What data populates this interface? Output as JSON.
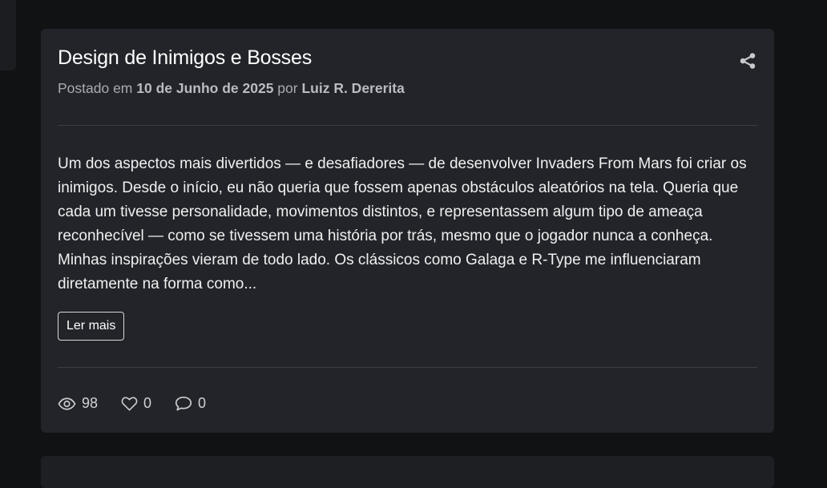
{
  "post": {
    "title": "Design de Inimigos e Bosses",
    "meta_prefix": "Postado em ",
    "date": "10 de Junho de 2025",
    "meta_by": " por ",
    "author": "Luiz R. Dererita",
    "excerpt": "Um dos aspectos mais divertidos — e desafiadores — de desenvolver Invaders From Mars foi criar os inimigos. Desde o início, eu não queria que fossem apenas obstáculos aleatórios na tela. Queria que cada um tivesse personalidade, movimentos distintos, e representassem algum tipo de ameaça reconhecível — como se tivessem uma história por trás, mesmo que o jogador nunca a conheça. Minhas inspirações vieram de todo lado. Os clássicos como Galaga e R-Type me influenciaram diretamente na forma como...",
    "read_more_label": "Ler mais",
    "stats": {
      "views": "98",
      "likes": "0",
      "comments": "0"
    },
    "icons": {
      "share": "share-icon",
      "views": "eye-icon",
      "likes": "heart-icon",
      "comments": "comment-icon"
    }
  },
  "colors": {
    "page_bg": "#111213",
    "card_bg": "#222429",
    "divider": "#3a3d43"
  }
}
